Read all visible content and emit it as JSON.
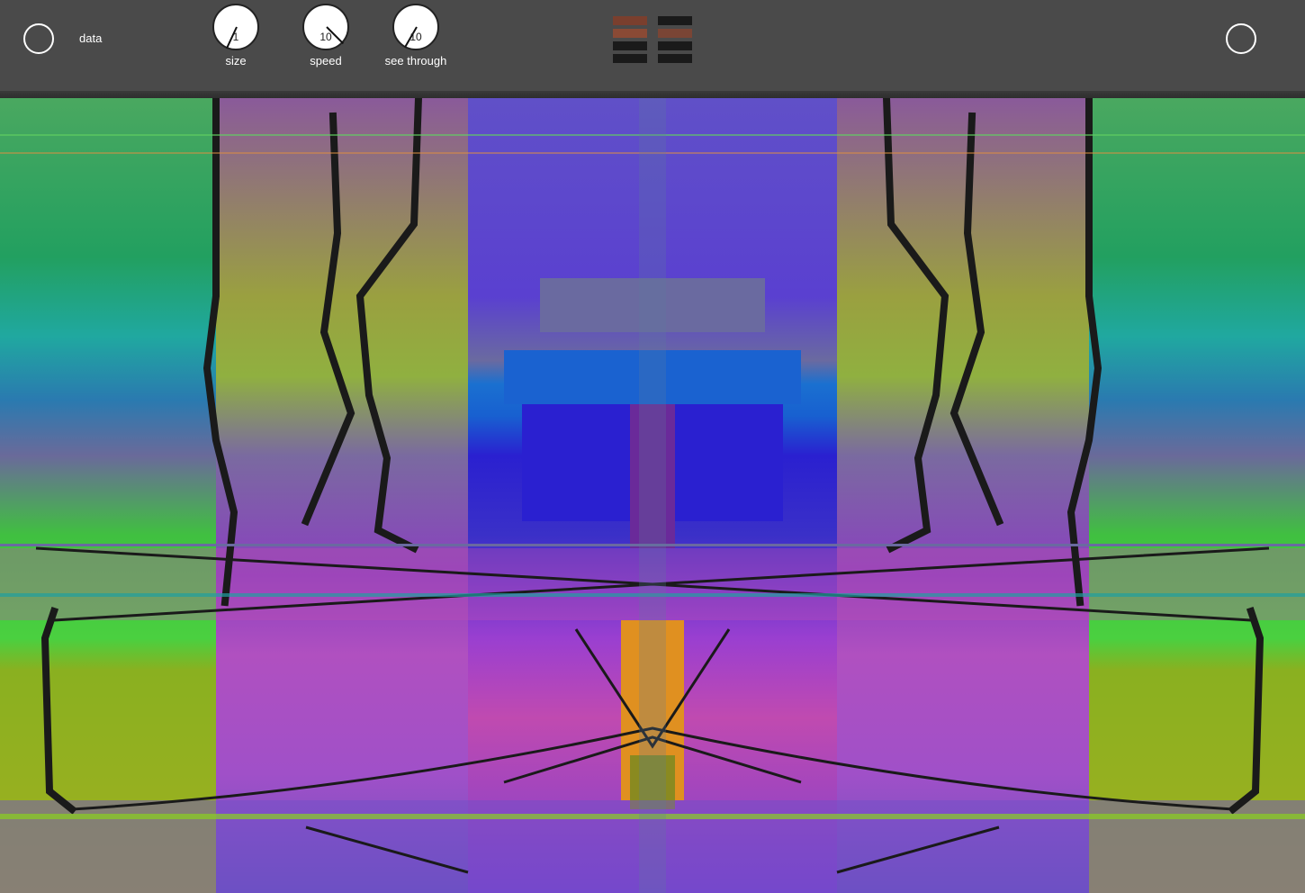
{
  "toolbar": {
    "data_label": "data",
    "knobs": [
      {
        "label": "size",
        "value": "1"
      },
      {
        "label": "speed",
        "value": "10"
      },
      {
        "label": "see through",
        "value": "10"
      }
    ],
    "palette_left": [
      "#7a3f2e",
      "#8a4a35",
      "#1a1a1a",
      "#1a1a1a"
    ],
    "palette_right": [
      "#1a1a1a",
      "#7a4535",
      "#1a1a1a",
      "#1a1a1a"
    ]
  },
  "colors": {
    "topbar": "#4a4a4a",
    "accent_green": "#3cc24a",
    "accent_purple": "#9a3fd0",
    "accent_blue": "#2a4fd6"
  },
  "icons": [
    "circle-icon-left",
    "circle-icon-right"
  ]
}
